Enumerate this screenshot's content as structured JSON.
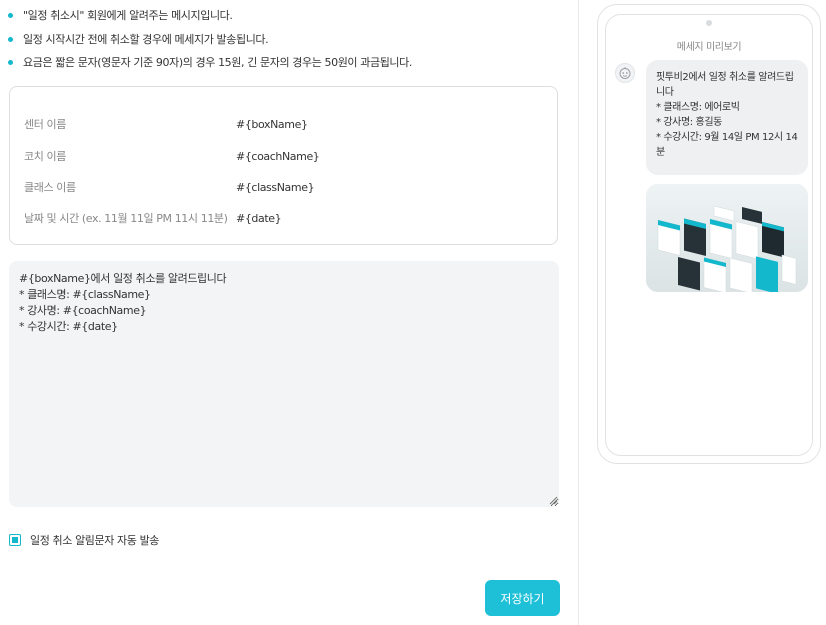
{
  "notes": [
    "\"일정 취소시\" 회원에게 알려주는 메시지입니다.",
    "일정 시작시간 전에 취소할 경우에 메세지가 발송됩니다.",
    "요금은 짧은 문자(영문자 기준 90자)의 경우 15원, 긴 문자의 경우는 50원이 과금됩니다."
  ],
  "variables": [
    {
      "label": "센터 이름",
      "value": "#{boxName}"
    },
    {
      "label": "코치 이름",
      "value": "#{coachName}"
    },
    {
      "label": "클래스 이름",
      "value": "#{className}"
    },
    {
      "label": "날짜 및 시간 (ex. 11월 11일 PM 11시 11분)",
      "value": "#{date}"
    }
  ],
  "template_text": "#{boxName}에서 일정 취소를 알려드립니다\n* 클래스명: #{className}\n* 강사명: #{coachName}\n* 수강시간: #{date}",
  "auto_send_label": "일정 취소 알림문자 자동 발송",
  "auto_send_checked": true,
  "save_label": "저장하기",
  "preview": {
    "title": "메세지 미리보기",
    "lines": [
      "핏투비2에서 일정 취소를 알려드립니다",
      "* 클래스명: 에어로빅",
      "* 강사명: 홍길동",
      "* 수강시간: 9월 14일 PM 12시 14분"
    ]
  },
  "colors": {
    "accent": "#14b8cc",
    "button": "#1ec0d8",
    "textarea_bg": "#f2f4f5",
    "bubble_bg": "#eef0f1"
  }
}
